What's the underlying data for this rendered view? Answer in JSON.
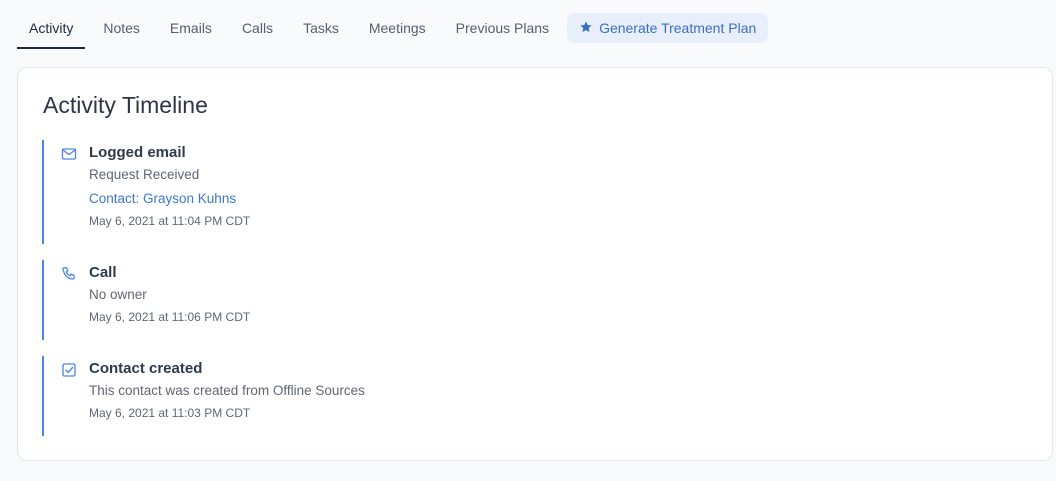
{
  "tabs": [
    {
      "label": "Activity",
      "active": true
    },
    {
      "label": "Notes"
    },
    {
      "label": "Emails"
    },
    {
      "label": "Calls"
    },
    {
      "label": "Tasks"
    },
    {
      "label": "Meetings"
    },
    {
      "label": "Previous Plans"
    }
  ],
  "generate_button": {
    "label": "Generate Treatment Plan",
    "icon": "star-icon"
  },
  "timeline": {
    "title": "Activity Timeline",
    "items": [
      {
        "icon": "mail-icon",
        "title": "Logged email",
        "subtitle": "Request Received",
        "link": "Contact: Grayson Kuhns",
        "date": "May 6, 2021 at 11:04 PM CDT"
      },
      {
        "icon": "phone-icon",
        "title": "Call",
        "subtitle": "No owner",
        "date": "May 6, 2021 at 11:06 PM CDT"
      },
      {
        "icon": "checkbox-icon",
        "title": "Contact created",
        "subtitle": "This contact was created from Offline Sources",
        "date": "May 6, 2021 at 11:03 PM CDT"
      }
    ]
  },
  "colors": {
    "accent": "#4a86e0",
    "link": "#3d78cf",
    "button_bg": "#e8effa"
  }
}
